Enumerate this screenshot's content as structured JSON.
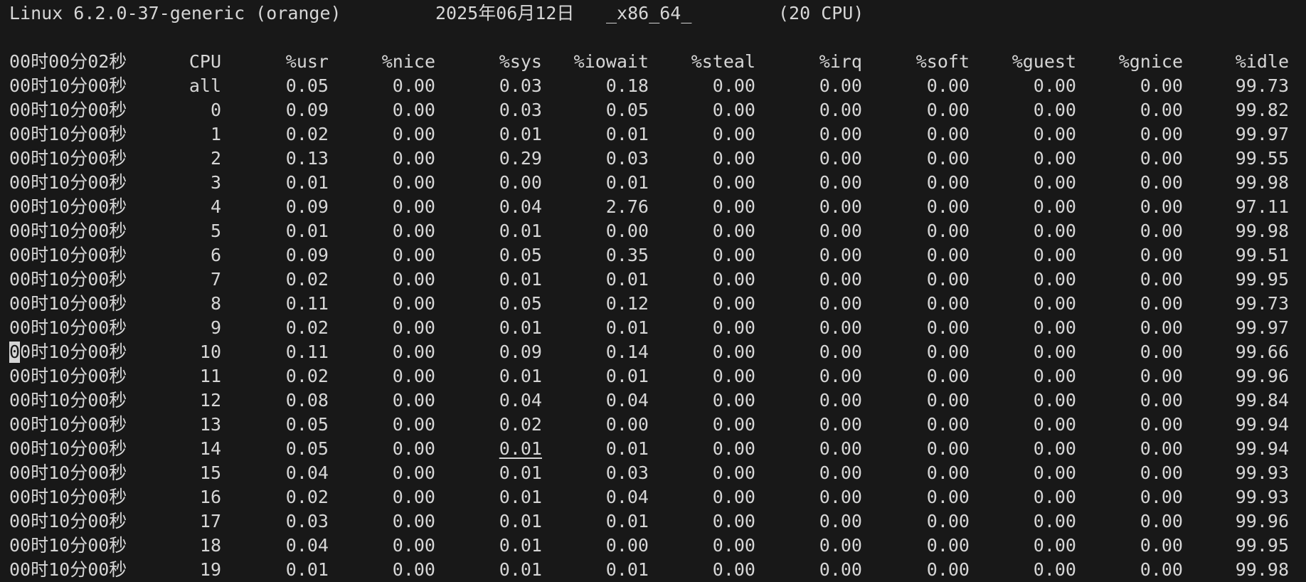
{
  "header": {
    "system": "Linux 6.2.0-37-generic (orange)",
    "date": "2025年06月12日",
    "arch": "_x86_64_",
    "cpus": "(20 CPU)"
  },
  "columns": {
    "time": "00时00分02秒",
    "cpu": "CPU",
    "usr": "%usr",
    "nice": "%nice",
    "sys": "%sys",
    "iowait": "%iowait",
    "steal": "%steal",
    "irq": "%irq",
    "soft": "%soft",
    "guest": "%guest",
    "gnice": "%gnice",
    "idle": "%idle"
  },
  "rows": [
    {
      "time": "00时10分00秒",
      "cpu": "all",
      "usr": "0.05",
      "nice": "0.00",
      "sys": "0.03",
      "iowait": "0.18",
      "steal": "0.00",
      "irq": "0.00",
      "soft": "0.00",
      "guest": "0.00",
      "gnice": "0.00",
      "idle": "99.73"
    },
    {
      "time": "00时10分00秒",
      "cpu": "0",
      "usr": "0.09",
      "nice": "0.00",
      "sys": "0.03",
      "iowait": "0.05",
      "steal": "0.00",
      "irq": "0.00",
      "soft": "0.00",
      "guest": "0.00",
      "gnice": "0.00",
      "idle": "99.82"
    },
    {
      "time": "00时10分00秒",
      "cpu": "1",
      "usr": "0.02",
      "nice": "0.00",
      "sys": "0.01",
      "iowait": "0.01",
      "steal": "0.00",
      "irq": "0.00",
      "soft": "0.00",
      "guest": "0.00",
      "gnice": "0.00",
      "idle": "99.97"
    },
    {
      "time": "00时10分00秒",
      "cpu": "2",
      "usr": "0.13",
      "nice": "0.00",
      "sys": "0.29",
      "iowait": "0.03",
      "steal": "0.00",
      "irq": "0.00",
      "soft": "0.00",
      "guest": "0.00",
      "gnice": "0.00",
      "idle": "99.55"
    },
    {
      "time": "00时10分00秒",
      "cpu": "3",
      "usr": "0.01",
      "nice": "0.00",
      "sys": "0.00",
      "iowait": "0.01",
      "steal": "0.00",
      "irq": "0.00",
      "soft": "0.00",
      "guest": "0.00",
      "gnice": "0.00",
      "idle": "99.98"
    },
    {
      "time": "00时10分00秒",
      "cpu": "4",
      "usr": "0.09",
      "nice": "0.00",
      "sys": "0.04",
      "iowait": "2.76",
      "steal": "0.00",
      "irq": "0.00",
      "soft": "0.00",
      "guest": "0.00",
      "gnice": "0.00",
      "idle": "97.11"
    },
    {
      "time": "00时10分00秒",
      "cpu": "5",
      "usr": "0.01",
      "nice": "0.00",
      "sys": "0.01",
      "iowait": "0.00",
      "steal": "0.00",
      "irq": "0.00",
      "soft": "0.00",
      "guest": "0.00",
      "gnice": "0.00",
      "idle": "99.98"
    },
    {
      "time": "00时10分00秒",
      "cpu": "6",
      "usr": "0.09",
      "nice": "0.00",
      "sys": "0.05",
      "iowait": "0.35",
      "steal": "0.00",
      "irq": "0.00",
      "soft": "0.00",
      "guest": "0.00",
      "gnice": "0.00",
      "idle": "99.51"
    },
    {
      "time": "00时10分00秒",
      "cpu": "7",
      "usr": "0.02",
      "nice": "0.00",
      "sys": "0.01",
      "iowait": "0.01",
      "steal": "0.00",
      "irq": "0.00",
      "soft": "0.00",
      "guest": "0.00",
      "gnice": "0.00",
      "idle": "99.95"
    },
    {
      "time": "00时10分00秒",
      "cpu": "8",
      "usr": "0.11",
      "nice": "0.00",
      "sys": "0.05",
      "iowait": "0.12",
      "steal": "0.00",
      "irq": "0.00",
      "soft": "0.00",
      "guest": "0.00",
      "gnice": "0.00",
      "idle": "99.73"
    },
    {
      "time": "00时10分00秒",
      "cpu": "9",
      "usr": "0.02",
      "nice": "0.00",
      "sys": "0.01",
      "iowait": "0.01",
      "steal": "0.00",
      "irq": "0.00",
      "soft": "0.00",
      "guest": "0.00",
      "gnice": "0.00",
      "idle": "99.97"
    },
    {
      "time": "00时10分00秒",
      "cpu": "10",
      "usr": "0.11",
      "nice": "0.00",
      "sys": "0.09",
      "iowait": "0.14",
      "steal": "0.00",
      "irq": "0.00",
      "soft": "0.00",
      "guest": "0.00",
      "gnice": "0.00",
      "idle": "99.66"
    },
    {
      "time": "00时10分00秒",
      "cpu": "11",
      "usr": "0.02",
      "nice": "0.00",
      "sys": "0.01",
      "iowait": "0.01",
      "steal": "0.00",
      "irq": "0.00",
      "soft": "0.00",
      "guest": "0.00",
      "gnice": "0.00",
      "idle": "99.96"
    },
    {
      "time": "00时10分00秒",
      "cpu": "12",
      "usr": "0.08",
      "nice": "0.00",
      "sys": "0.04",
      "iowait": "0.04",
      "steal": "0.00",
      "irq": "0.00",
      "soft": "0.00",
      "guest": "0.00",
      "gnice": "0.00",
      "idle": "99.84"
    },
    {
      "time": "00时10分00秒",
      "cpu": "13",
      "usr": "0.05",
      "nice": "0.00",
      "sys": "0.02",
      "iowait": "0.00",
      "steal": "0.00",
      "irq": "0.00",
      "soft": "0.00",
      "guest": "0.00",
      "gnice": "0.00",
      "idle": "99.94"
    },
    {
      "time": "00时10分00秒",
      "cpu": "14",
      "usr": "0.05",
      "nice": "0.00",
      "sys": "0.01",
      "iowait": "0.01",
      "steal": "0.00",
      "irq": "0.00",
      "soft": "0.00",
      "guest": "0.00",
      "gnice": "0.00",
      "idle": "99.94"
    },
    {
      "time": "00时10分00秒",
      "cpu": "15",
      "usr": "0.04",
      "nice": "0.00",
      "sys": "0.01",
      "iowait": "0.03",
      "steal": "0.00",
      "irq": "0.00",
      "soft": "0.00",
      "guest": "0.00",
      "gnice": "0.00",
      "idle": "99.93"
    },
    {
      "time": "00时10分00秒",
      "cpu": "16",
      "usr": "0.02",
      "nice": "0.00",
      "sys": "0.01",
      "iowait": "0.04",
      "steal": "0.00",
      "irq": "0.00",
      "soft": "0.00",
      "guest": "0.00",
      "gnice": "0.00",
      "idle": "99.93"
    },
    {
      "time": "00时10分00秒",
      "cpu": "17",
      "usr": "0.03",
      "nice": "0.00",
      "sys": "0.01",
      "iowait": "0.01",
      "steal": "0.00",
      "irq": "0.00",
      "soft": "0.00",
      "guest": "0.00",
      "gnice": "0.00",
      "idle": "99.96"
    },
    {
      "time": "00时10分00秒",
      "cpu": "18",
      "usr": "0.04",
      "nice": "0.00",
      "sys": "0.01",
      "iowait": "0.00",
      "steal": "0.00",
      "irq": "0.00",
      "soft": "0.00",
      "guest": "0.00",
      "gnice": "0.00",
      "idle": "99.95"
    },
    {
      "time": "00时10分00秒",
      "cpu": "19",
      "usr": "0.01",
      "nice": "0.00",
      "sys": "0.01",
      "iowait": "0.01",
      "steal": "0.00",
      "irq": "0.00",
      "soft": "0.00",
      "guest": "0.00",
      "gnice": "0.00",
      "idle": "99.98"
    }
  ],
  "colors": {
    "background": "#181818",
    "foreground": "#d6d6d6"
  }
}
